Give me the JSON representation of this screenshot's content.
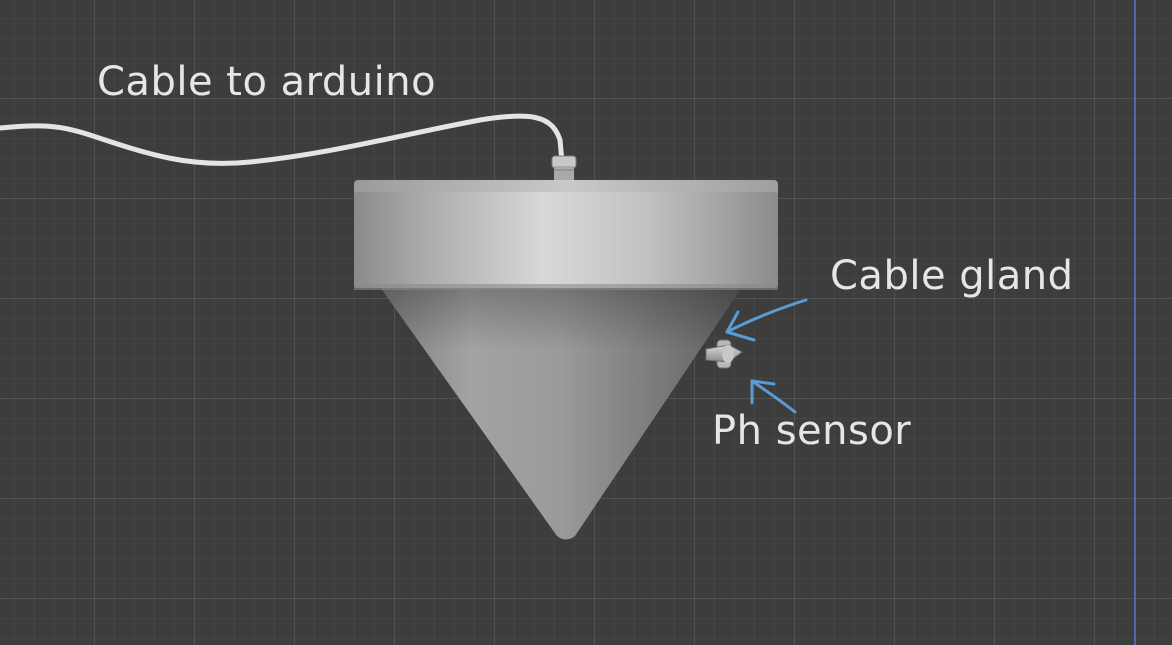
{
  "labels": {
    "cable": "Cable to arduino",
    "gland": "Cable gland",
    "ph": "Ph sensor"
  },
  "colors": {
    "background": "#3d3d3d",
    "grid": "#4a4a4a",
    "annotation_arrow": "#5b9bd5",
    "text": "#e6e6e6",
    "viewport_edge_line": "#4f6aa6"
  },
  "icons": {
    "cable": "cable-shape",
    "housing": "cylinder-lid-shape",
    "cone": "cone-body-shape"
  }
}
